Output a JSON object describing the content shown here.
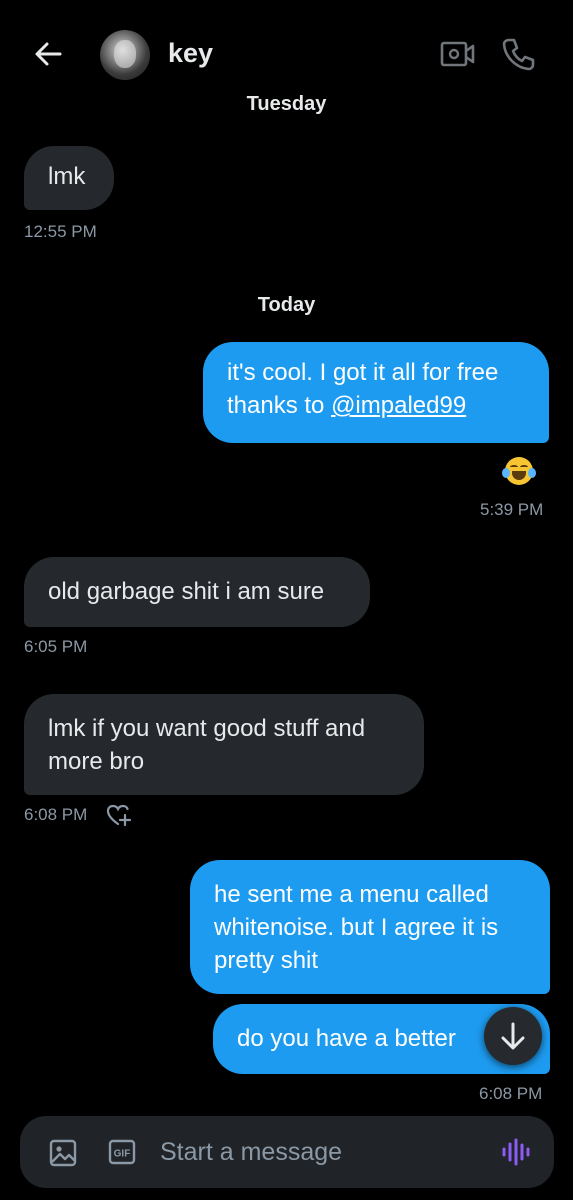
{
  "header": {
    "contact_name": "key"
  },
  "conversation": {
    "sections": [
      {
        "day": "Tuesday",
        "messages": [
          {
            "direction": "incoming",
            "text": "lmk",
            "time": "12:55 PM"
          }
        ]
      },
      {
        "day": "Today",
        "messages": [
          {
            "direction": "outgoing",
            "text": "it's cool. I got it all for free thanks to ",
            "mention": "@impaled99",
            "reaction": "face-with-tears-of-joy",
            "time": "5:39 PM"
          },
          {
            "direction": "incoming",
            "text": "old garbage shit i am sure",
            "time": "6:05 PM"
          },
          {
            "direction": "incoming",
            "text": "lmk if you want good stuff and more bro",
            "time": "6:08 PM"
          },
          {
            "direction": "outgoing",
            "text": "he sent me a menu called whitenoise. but I agree it is pretty shit"
          },
          {
            "direction": "outgoing",
            "text": "do you have a better",
            "time": "6:08 PM"
          }
        ]
      }
    ]
  },
  "composer": {
    "placeholder": "Start a message",
    "gif_label": "GIF"
  },
  "colors": {
    "background": "#000000",
    "incoming_bubble": "#25292d",
    "outgoing_bubble": "#1d9bf0",
    "timestamp": "#8b98a5",
    "voice_accent": "#8b5cf6"
  }
}
